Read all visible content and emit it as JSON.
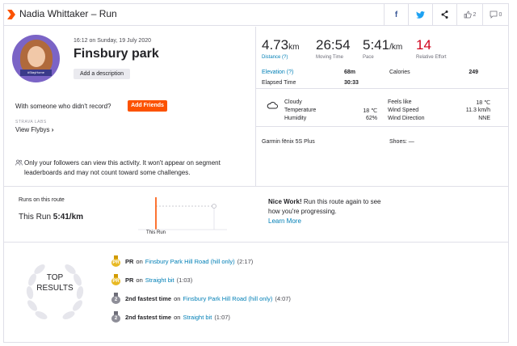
{
  "header": {
    "title": "Nadia Whittaker – Run",
    "kudos_count": "2",
    "comments_count": "0",
    "icons": [
      "strava-chevron-icon",
      "facebook-icon",
      "twitter-icon",
      "share-icon",
      "kudos-icon",
      "comment-icon"
    ]
  },
  "activity": {
    "avatar_tag": "#StayHome",
    "datetime": "16:12 on Sunday, 19 July 2020",
    "name": "Finsbury park",
    "add_description": "Add a description",
    "with_someone": "With someone who didn't record?",
    "add_friends": "Add Friends",
    "labs_label": "STRAVA LABS",
    "view_flybys": "View Flybys",
    "privacy_note": "Only your followers can view this activity. It won't appear on segment leaderboards and may not count toward some challenges."
  },
  "stats": {
    "distance_value": "4.73",
    "distance_unit": "km",
    "distance_label": "Distance (?)",
    "moving_time_value": "26:54",
    "moving_time_label": "Moving Time",
    "pace_value": "5:41",
    "pace_unit": "/km",
    "pace_label": "Pace",
    "relative_effort_value": "14",
    "relative_effort_label": "Relative Effort",
    "elevation_label": "Elevation (?)",
    "elevation_value": "68m",
    "calories_label": "Calories",
    "calories_value": "249",
    "elapsed_label": "Elapsed Time",
    "elapsed_value": "30:33"
  },
  "weather": {
    "condition": "Cloudy",
    "temperature_label": "Temperature",
    "temperature_value": "18 ℃",
    "humidity_label": "Humidity",
    "humidity_value": "62%",
    "feels_like_label": "Feels like",
    "feels_like_value": "18 ℃",
    "wind_speed_label": "Wind Speed",
    "wind_speed_value": "11.3 km/h",
    "wind_direction_label": "Wind Direction",
    "wind_direction_value": "NNE"
  },
  "gear": {
    "device": "Garmin fēnix 5S Plus",
    "shoes": "Shoes: —"
  },
  "route": {
    "label": "Runs on this route",
    "this_run_prefix": "This Run",
    "this_run_pace": "5:41/km",
    "chart_caption": "This Run",
    "nice_work_bold": "Nice Work!",
    "nice_work_text": " Run this route again to see how you're progressing.",
    "learn_more": "Learn More"
  },
  "top_results": {
    "title_line1": "TOP",
    "title_line2": "RESULTS",
    "items": [
      {
        "type": "PR",
        "on": "on",
        "segment": "Finsbury Park Hill Road (hill only)",
        "time": "(2:17)",
        "medal": "gold",
        "medal_text": "PR"
      },
      {
        "type": "PR",
        "on": "on",
        "segment": "Straight bit",
        "time": "(1:03)",
        "medal": "gold",
        "medal_text": "PR"
      },
      {
        "type": "2nd fastest time",
        "on": "on",
        "segment": "Finsbury Park Hill Road (hill only)",
        "time": "(4:07)",
        "medal": "silver",
        "medal_text": "2"
      },
      {
        "type": "2nd fastest time",
        "on": "on",
        "segment": "Straight bit",
        "time": "(1:07)",
        "medal": "silver",
        "medal_text": "2"
      }
    ]
  },
  "colors": {
    "brand": "#fc5200",
    "link": "#007fb6",
    "effort": "#d0021b",
    "gold": "#e8b923",
    "silver": "#8e8e98"
  }
}
